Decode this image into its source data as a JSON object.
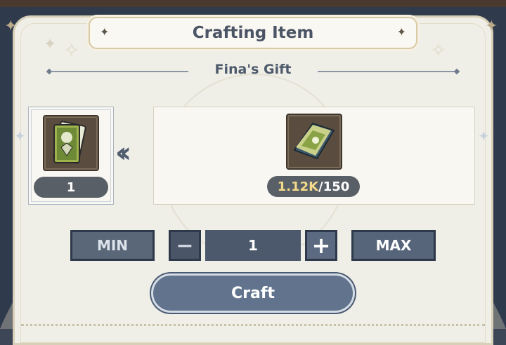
{
  "dialog": {
    "title": "Crafting Item",
    "subtitle": "Fina's Gift"
  },
  "source_item": {
    "icon": "tarot-card-icon",
    "count": "1"
  },
  "target_item": {
    "icon": "card-material-icon",
    "owned": "1.12K",
    "required": "/150"
  },
  "quantity": {
    "min_label": "MIN",
    "max_label": "MAX",
    "minus_label": "−",
    "plus_label": "+",
    "value": "1"
  },
  "craft_button": {
    "label": "Craft"
  },
  "colors": {
    "panel_bg": "#efeee7",
    "button_bg": "#56657a",
    "craft_bg": "#62748d",
    "owned_text": "#f3d98a"
  }
}
